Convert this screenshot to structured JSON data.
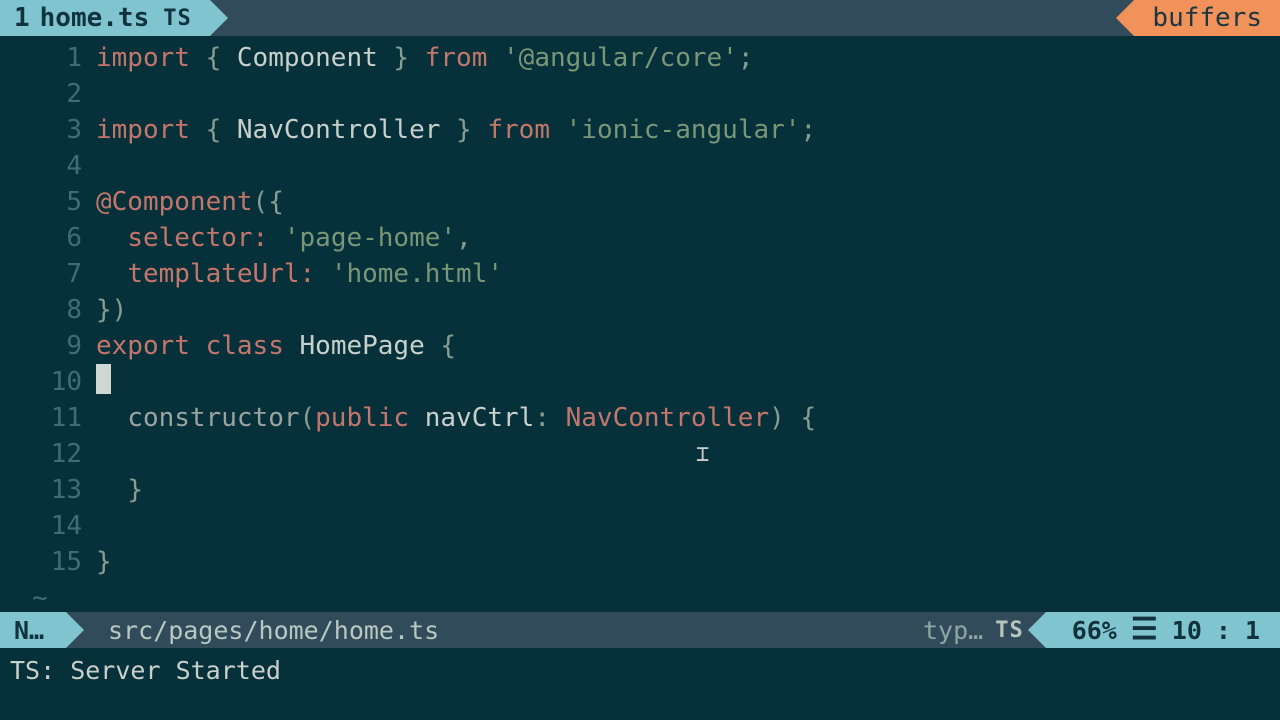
{
  "tab": {
    "number": "1",
    "filename": "home.ts",
    "filetype": "TS"
  },
  "buffers_label": "buffers",
  "code": {
    "l1": {
      "kw1": "import",
      "p1": " { ",
      "id": "Component",
      "p2": " } ",
      "kw2": "from",
      "sp": " ",
      "str": "'@angular/core'",
      "end": ";"
    },
    "l3": {
      "kw1": "import",
      "p1": " { ",
      "id": "NavController",
      "p2": " } ",
      "kw2": "from",
      "sp": " ",
      "str": "'ionic-angular'",
      "end": ";"
    },
    "l5": {
      "dec": "@Component",
      "p": "({"
    },
    "l6": {
      "indent": "  ",
      "key": "selector:",
      "sp": " ",
      "str": "'page-home'",
      "end": ","
    },
    "l7": {
      "indent": "  ",
      "key": "templateUrl:",
      "sp": " ",
      "str": "'home.html'"
    },
    "l8": {
      "p": "})"
    },
    "l9": {
      "kw1": "export",
      "sp1": " ",
      "kw2": "class",
      "sp2": " ",
      "id": "HomePage",
      "sp3": " ",
      "p": "{"
    },
    "l11": {
      "indent": "  ",
      "fn": "constructor",
      "p1": "(",
      "kw": "public",
      "sp": " ",
      "id": "navCtrl",
      "colon": ": ",
      "type": "NavController",
      "p2": ")",
      "sp2": " ",
      "p3": "{"
    },
    "l13": {
      "indent": "  ",
      "p": "}"
    },
    "l15": {
      "p": "}"
    }
  },
  "gutter": [
    "1",
    "2",
    "3",
    "4",
    "5",
    "6",
    "7",
    "8",
    "9",
    "10",
    "11",
    "12",
    "13",
    "14",
    "15"
  ],
  "status": {
    "mode": "N…",
    "path": "src/pages/home/home.ts",
    "filetype_label": "typ…",
    "filetype_badge": "TS",
    "percent": "66%",
    "line": "10",
    "col": "1"
  },
  "message": "TS: Server Started"
}
